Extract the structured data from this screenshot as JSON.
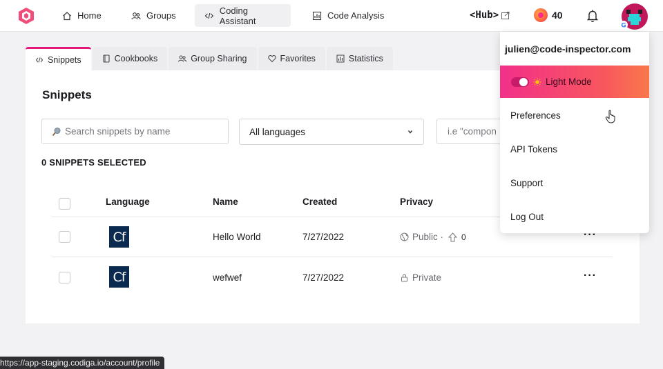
{
  "nav": {
    "home": "Home",
    "groups": "Groups",
    "coding_assistant": "Coding Assistant",
    "code_analysis": "Code Analysis",
    "hub": "<Hub>",
    "coins": "40"
  },
  "tabs": [
    "Snippets",
    "Cookbooks",
    "Group Sharing",
    "Favorites",
    "Statistics"
  ],
  "main": {
    "title": "Snippets",
    "search_placeholder": "Search snippets by name",
    "language_select": "All languages",
    "tag_placeholder": "i.e \"compon",
    "selected_count": "0 SNIPPETS SELECTED"
  },
  "table": {
    "headers": [
      "Language",
      "Name",
      "Created",
      "Privacy"
    ],
    "rows": [
      {
        "language_badge": "Cf",
        "name": "Hello World",
        "created": "7/27/2022",
        "privacy": "Public ·",
        "votes": "0"
      },
      {
        "language_badge": "Cf",
        "name": "wefwef",
        "created": "7/27/2022",
        "privacy": "Private"
      }
    ]
  },
  "dropdown": {
    "email": "julien@code-inspector.com",
    "mode": "Light Mode",
    "items": [
      "Preferences",
      "API Tokens",
      "Support",
      "Log Out"
    ]
  },
  "status_url": "https://app-staging.codiga.io/account/profile",
  "colors": {
    "accent": "#e3177a",
    "mode_gradient_start": "#f2308a",
    "mode_gradient_end": "#f8784a",
    "cf_badge": "#0b2a4f"
  }
}
